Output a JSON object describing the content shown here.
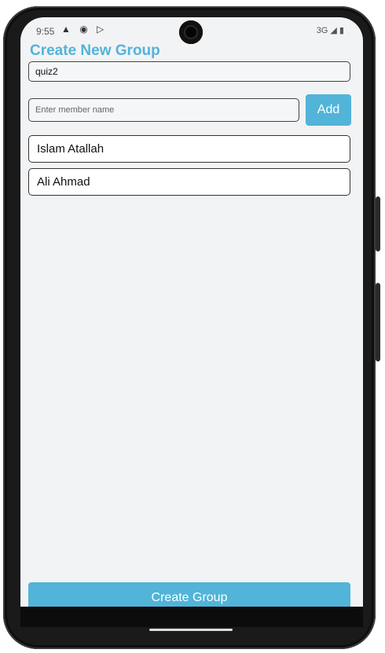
{
  "status_bar": {
    "time": "9:55",
    "left_icons": "▲ ◉ ▷",
    "right_text": "3G ◢ ▮"
  },
  "header": {
    "title": "Create New Group"
  },
  "group_name_input": {
    "value": "quiz2"
  },
  "member_input": {
    "placeholder": "Enter member name",
    "add_label": "Add"
  },
  "members": [
    {
      "name": "Islam Atallah"
    },
    {
      "name": "Ali Ahmad"
    }
  ],
  "footer": {
    "create_label": "Create Group"
  },
  "colors": {
    "accent": "#52b4d8",
    "background": "#f2f3f5"
  }
}
